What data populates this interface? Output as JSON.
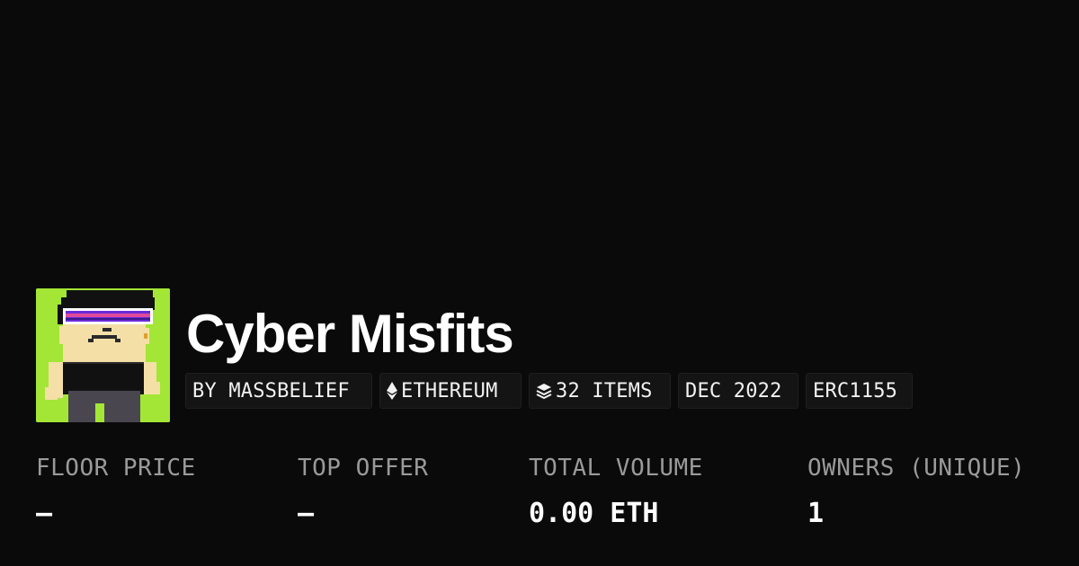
{
  "collection": {
    "name": "Cyber Misfits",
    "avatar_bg": "#a3e635"
  },
  "chips": {
    "creator": "BY MASSBELIEF",
    "chain": "ETHEREUM",
    "chain_icon": "ethereum-icon",
    "items": "32 ITEMS",
    "items_icon": "layers-icon",
    "date": "DEC 2022",
    "standard": "ERC1155"
  },
  "stats": {
    "floor_price": {
      "label": "FLOOR PRICE",
      "value": "–"
    },
    "top_offer": {
      "label": "TOP OFFER",
      "value": "–"
    },
    "total_volume": {
      "label": "TOTAL VOLUME",
      "value": "0.00 ETH"
    },
    "owners": {
      "label": "OWNERS (UNIQUE)",
      "value": "1"
    }
  },
  "colors": {
    "background": "#0a0a0a",
    "text": "#ffffff",
    "muted": "#9a9a9a",
    "chip_bg": "#141414"
  }
}
